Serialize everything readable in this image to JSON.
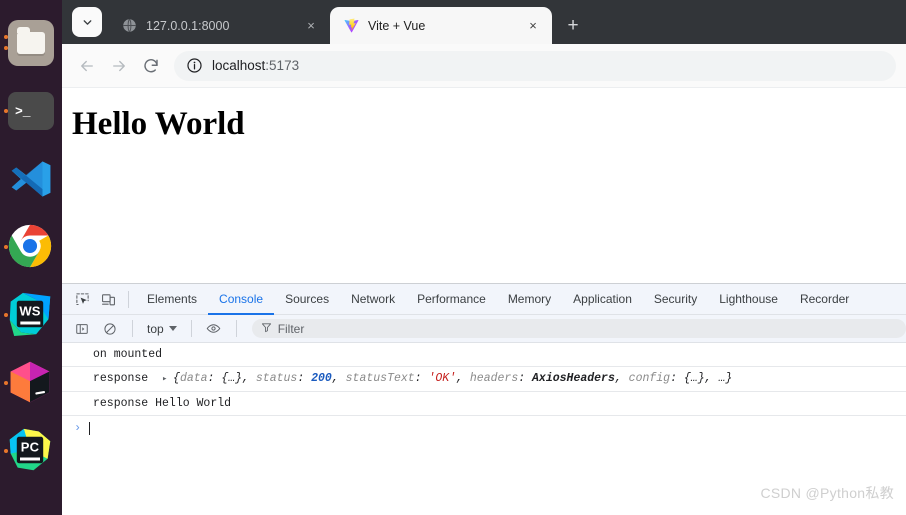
{
  "dock": {
    "items": [
      {
        "name": "files",
        "label": "Files",
        "indicators": 2
      },
      {
        "name": "terminal",
        "label": "Terminal",
        "glyph": ">_",
        "indicators": 1
      },
      {
        "name": "vscode",
        "label": "Visual Studio Code",
        "indicators": 0
      },
      {
        "name": "chrome",
        "label": "Google Chrome",
        "indicators": 1
      },
      {
        "name": "webstorm",
        "label": "WebStorm",
        "glyph": "WS",
        "indicators": 1
      },
      {
        "name": "datagrip",
        "label": "DataGrip",
        "glyph": "",
        "indicators": 1
      },
      {
        "name": "pycharm",
        "label": "PyCharm",
        "glyph": "PC",
        "indicators": 1
      }
    ],
    "background": "#2c1b2d"
  },
  "browser": {
    "tabs": [
      {
        "title": "127.0.0.1:8000",
        "favicon": "globe-icon",
        "active": false,
        "close_label": "×"
      },
      {
        "title": "Vite + Vue",
        "favicon": "vite-logo-icon",
        "active": true,
        "close_label": "×"
      }
    ],
    "new_tab_label": "+",
    "tab_search_label": "˅",
    "toolbar": {
      "back_label": "←",
      "forward_label": "→",
      "reload_label": "⟳",
      "url_host": "localhost",
      "url_port": ":5173",
      "url_full": "localhost:5173",
      "site_info_icon": "info-circle-icon"
    }
  },
  "page": {
    "heading": "Hello World"
  },
  "devtools": {
    "left_buttons": [
      {
        "name": "inspect-element-icon",
        "label": "Inspect element"
      },
      {
        "name": "device-toolbar-icon",
        "label": "Toggle device toolbar"
      }
    ],
    "tabs": [
      {
        "label": "Elements",
        "selected": false
      },
      {
        "label": "Console",
        "selected": true
      },
      {
        "label": "Sources",
        "selected": false
      },
      {
        "label": "Network",
        "selected": false
      },
      {
        "label": "Performance",
        "selected": false
      },
      {
        "label": "Memory",
        "selected": false
      },
      {
        "label": "Application",
        "selected": false
      },
      {
        "label": "Security",
        "selected": false
      },
      {
        "label": "Lighthouse",
        "selected": false
      },
      {
        "label": "Recorder",
        "selected": false
      }
    ],
    "filterbar": {
      "sidebar_toggle_icon": "console-sidebar-icon",
      "clear_console_icon": "clear-console-icon",
      "context": "top",
      "eye_icon": "live-expression-eye-icon",
      "filter_icon": "filter-funnel-icon",
      "filter_placeholder": "Filter",
      "filter_value": ""
    },
    "console": {
      "messages": [
        {
          "type": "log",
          "text": "on mounted"
        },
        {
          "type": "object",
          "label": "response",
          "disclosure": "▸",
          "parts": [
            {
              "t": "pun",
              "v": "{"
            },
            {
              "t": "k",
              "v": "data"
            },
            {
              "t": "pun",
              "v": ": "
            },
            {
              "t": "obj",
              "v": "{…}"
            },
            {
              "t": "pun",
              "v": ", "
            },
            {
              "t": "k",
              "v": "status"
            },
            {
              "t": "pun",
              "v": ": "
            },
            {
              "t": "num",
              "v": "200"
            },
            {
              "t": "pun",
              "v": ", "
            },
            {
              "t": "k",
              "v": "statusText"
            },
            {
              "t": "pun",
              "v": ": "
            },
            {
              "t": "str",
              "v": "'OK'"
            },
            {
              "t": "pun",
              "v": ", "
            },
            {
              "t": "k",
              "v": "headers"
            },
            {
              "t": "pun",
              "v": ": "
            },
            {
              "t": "cls",
              "v": "AxiosHeaders"
            },
            {
              "t": "pun",
              "v": ", "
            },
            {
              "t": "k",
              "v": "config"
            },
            {
              "t": "pun",
              "v": ": "
            },
            {
              "t": "obj",
              "v": "{…}"
            },
            {
              "t": "pun",
              "v": ", "
            },
            {
              "t": "obj",
              "v": "…}"
            }
          ]
        },
        {
          "type": "log",
          "text": "response Hello World"
        }
      ],
      "prompt_arrow": "❯",
      "prompt_value": ""
    }
  },
  "watermark": "CSDN @Python私教",
  "colors": {
    "accent": "#1a73e8",
    "tabstrip": "#323539",
    "devtools_bg": "#f2f5fb",
    "dock": "#2c1b2d",
    "number": "#1b5bbf",
    "string": "#c5221f"
  }
}
